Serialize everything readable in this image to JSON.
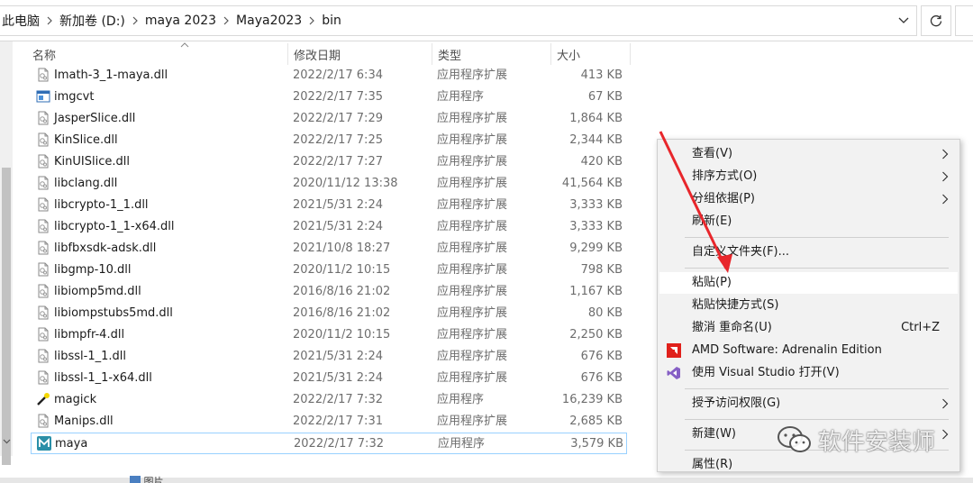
{
  "breadcrumb": [
    "此电脑",
    "新加卷 (D:)",
    "maya 2023",
    "Maya2023",
    "bin"
  ],
  "columns": {
    "name": "名称",
    "date": "修改日期",
    "type": "类型",
    "size": "大小"
  },
  "files": [
    {
      "name": "Imath-3_1-maya.dll",
      "date": "2022/2/17 6:34",
      "type": "应用程序扩展",
      "size": "413 KB",
      "icon": "dll-file-icon"
    },
    {
      "name": "imgcvt",
      "date": "2022/2/17 7:35",
      "type": "应用程序",
      "size": "67 KB",
      "icon": "application-icon"
    },
    {
      "name": "JasperSlice.dll",
      "date": "2022/2/17 7:29",
      "type": "应用程序扩展",
      "size": "1,864 KB",
      "icon": "dll-file-icon"
    },
    {
      "name": "KinSlice.dll",
      "date": "2022/2/17 7:25",
      "type": "应用程序扩展",
      "size": "2,344 KB",
      "icon": "dll-file-icon"
    },
    {
      "name": "KinUISlice.dll",
      "date": "2022/2/17 7:27",
      "type": "应用程序扩展",
      "size": "420 KB",
      "icon": "dll-file-icon"
    },
    {
      "name": "libclang.dll",
      "date": "2020/11/12 13:38",
      "type": "应用程序扩展",
      "size": "41,564 KB",
      "icon": "dll-file-icon"
    },
    {
      "name": "libcrypto-1_1.dll",
      "date": "2021/5/31 2:24",
      "type": "应用程序扩展",
      "size": "3,333 KB",
      "icon": "dll-file-icon"
    },
    {
      "name": "libcrypto-1_1-x64.dll",
      "date": "2021/5/31 2:24",
      "type": "应用程序扩展",
      "size": "3,333 KB",
      "icon": "dll-file-icon"
    },
    {
      "name": "libfbxsdk-adsk.dll",
      "date": "2021/10/8 18:27",
      "type": "应用程序扩展",
      "size": "9,299 KB",
      "icon": "dll-file-icon"
    },
    {
      "name": "libgmp-10.dll",
      "date": "2020/11/2 10:15",
      "type": "应用程序扩展",
      "size": "798 KB",
      "icon": "dll-file-icon"
    },
    {
      "name": "libiomp5md.dll",
      "date": "2016/8/16 21:02",
      "type": "应用程序扩展",
      "size": "1,167 KB",
      "icon": "dll-file-icon"
    },
    {
      "name": "libiompstubs5md.dll",
      "date": "2016/8/16 21:02",
      "type": "应用程序扩展",
      "size": "80 KB",
      "icon": "dll-file-icon"
    },
    {
      "name": "libmpfr-4.dll",
      "date": "2020/11/2 10:15",
      "type": "应用程序扩展",
      "size": "2,250 KB",
      "icon": "dll-file-icon"
    },
    {
      "name": "libssl-1_1.dll",
      "date": "2021/5/31 2:24",
      "type": "应用程序扩展",
      "size": "676 KB",
      "icon": "dll-file-icon"
    },
    {
      "name": "libssl-1_1-x64.dll",
      "date": "2021/5/31 2:24",
      "type": "应用程序扩展",
      "size": "676 KB",
      "icon": "dll-file-icon"
    },
    {
      "name": "magick",
      "date": "2022/2/17 7:32",
      "type": "应用程序",
      "size": "16,239 KB",
      "icon": "magic-wand-icon"
    },
    {
      "name": "Manips.dll",
      "date": "2022/2/17 7:31",
      "type": "应用程序扩展",
      "size": "2,685 KB",
      "icon": "dll-file-icon"
    },
    {
      "name": "maya",
      "date": "2022/2/17 7:32",
      "type": "应用程序",
      "size": "3,579 KB",
      "icon": "maya-app-icon",
      "selected": true
    }
  ],
  "bottom_item": "图片",
  "context_menu": {
    "items": [
      {
        "label": "查看(V)",
        "submenu": true
      },
      {
        "label": "排序方式(O)",
        "submenu": true
      },
      {
        "label": "分组依据(P)",
        "submenu": true
      },
      {
        "label": "刷新(E)"
      },
      {
        "separator": true
      },
      {
        "label": "自定义文件夹(F)..."
      },
      {
        "separator": true
      },
      {
        "label": "粘贴(P)",
        "hover": true
      },
      {
        "label": "粘贴快捷方式(S)"
      },
      {
        "label": "撤消 重命名(U)",
        "shortcut": "Ctrl+Z"
      },
      {
        "label": "AMD Software: Adrenalin Edition",
        "icon": "amd-icon"
      },
      {
        "label": "使用 Visual Studio 打开(V)",
        "icon": "visual-studio-icon"
      },
      {
        "separator": true
      },
      {
        "label": "授予访问权限(G)",
        "submenu": true
      },
      {
        "separator": true
      },
      {
        "label": "新建(W)",
        "submenu": true
      },
      {
        "separator": true
      },
      {
        "label": "属性(R)"
      }
    ]
  },
  "watermark": "软件安装师",
  "colors": {
    "selection_border": "#99d1ff",
    "annotation_red": "#e8262b",
    "amd_red": "#e0201b",
    "vs_purple": "#865fc5"
  }
}
